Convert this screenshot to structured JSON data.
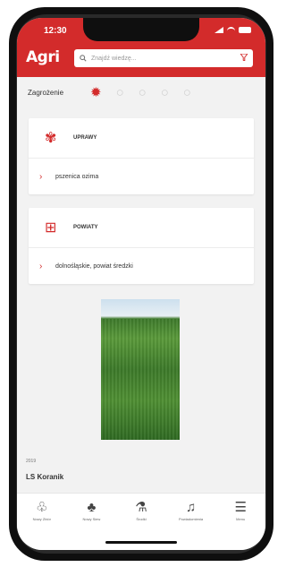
{
  "status": {
    "time": "12:30"
  },
  "header": {
    "logo": "Agri",
    "search_placeholder": "Znajdź wiedzę..."
  },
  "symptoms": {
    "label": "Zagrożenie",
    "icons": [
      "bug-icon",
      "bug-icon",
      "bug-icon",
      "bug-icon",
      "bug-icon"
    ]
  },
  "card_crops": {
    "header": "UPRAWY",
    "value": "pszenica ozima"
  },
  "card_district": {
    "header": "POWIATY",
    "value": "dolnośląskie, powiat średzki"
  },
  "meta": {
    "date": "2019"
  },
  "author": "LS Koranik",
  "nav": [
    {
      "label": "Nowy Zbiór",
      "icon": "sprout-icon"
    },
    {
      "label": "Nowy Siew",
      "icon": "seedling-icon"
    },
    {
      "label": "Środki",
      "icon": "bottle-icon"
    },
    {
      "label": "Powiadomienia",
      "icon": "bell-icon"
    },
    {
      "label": "Menu",
      "icon": "menu-icon"
    }
  ]
}
